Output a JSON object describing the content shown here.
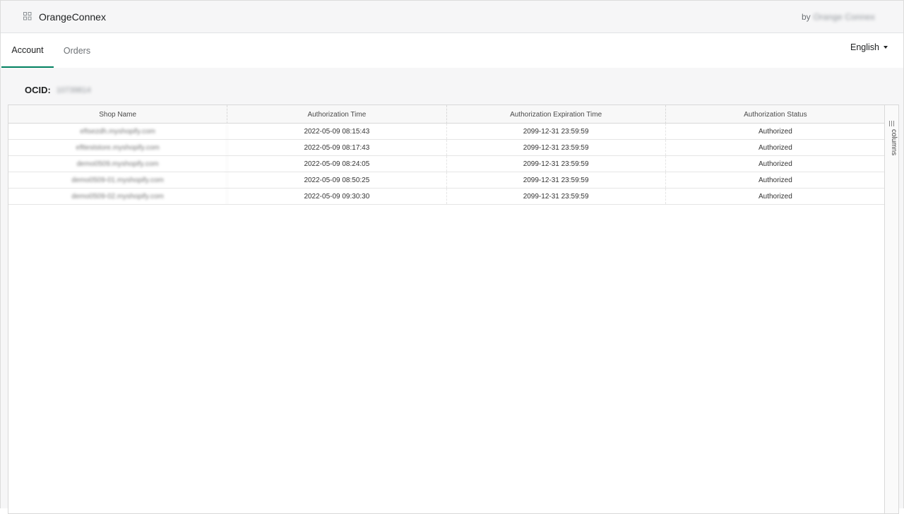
{
  "app": {
    "title": "OrangeConnex",
    "by_label": "by",
    "by_name": "Orange Connex",
    "icon": "apps-grid-icon"
  },
  "tabs": [
    {
      "label": "Account",
      "active": true
    },
    {
      "label": "Orders",
      "active": false
    }
  ],
  "language": {
    "selected": "English",
    "icon": "caret-down-icon"
  },
  "account": {
    "ocid_label": "OCID:",
    "ocid_value": "10739814"
  },
  "table": {
    "columns": [
      "Shop Name",
      "Authorization Time",
      "Authorization Expiration Time",
      "Authorization Status"
    ],
    "rows": [
      [
        "eftsezdh.myshopify.com",
        "2022-05-09 08:15:43",
        "2099-12-31 23:59:59",
        "Authorized"
      ],
      [
        "eftteststore.myshopify.com",
        "2022-05-09 08:17:43",
        "2099-12-31 23:59:59",
        "Authorized"
      ],
      [
        "demo0509.myshopify.com",
        "2022-05-09 08:24:05",
        "2099-12-31 23:59:59",
        "Authorized"
      ],
      [
        "demo0509-01.myshopify.com",
        "2022-05-09 08:50:25",
        "2099-12-31 23:59:59",
        "Authorized"
      ],
      [
        "demo0509-02.myshopify.com",
        "2022-05-09 09:30:30",
        "2099-12-31 23:59:59",
        "Authorized"
      ]
    ]
  },
  "side_panel": {
    "label": "columns",
    "icon": "columns-icon"
  },
  "colors": {
    "accent": "#008060",
    "topbar_bg": "#f6f6f7",
    "content_bg": "#f6f6f7"
  }
}
